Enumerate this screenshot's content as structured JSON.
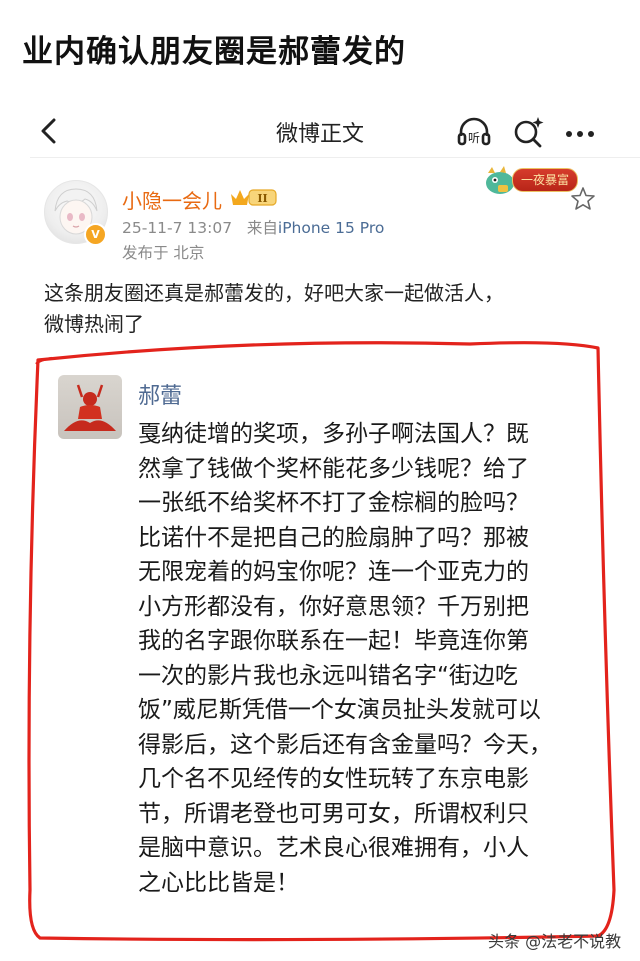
{
  "headline": "业内确认朋友圈是郝蕾发的",
  "navbar": {
    "back_icon": "chevron-left-icon",
    "title": "微博正文",
    "listen_label": "听",
    "search_icon": "search-sparkle-icon",
    "more_icon": "more-horizontal-icon"
  },
  "post": {
    "username": "小隐一会儿",
    "vip_level": "II",
    "timestamp": "25-11-7 13:07",
    "source_prefix": "来自",
    "device": "iPhone 15 Pro",
    "posted_from": "发布于 北京",
    "decoration_badge": "一夜暴富",
    "text_line1": "这条朋友圈还真是郝蕾发的，好吧大家一起做活人，",
    "text_line2": "微博热闹了"
  },
  "quoted": {
    "name": "郝蕾",
    "lines": [
      "戛纳徒增的奖项，多孙子啊法国人？既",
      "然拿了钱做个奖杯能花多少钱呢？给了",
      "一张纸不给奖杯不打了金棕榈的脸吗？",
      "比诺什不是把自己的脸扇肿了吗？那被",
      "无限宠着的妈宝你呢？连一个亚克力的",
      "小方形都没有，你好意思领？千万别把",
      "我的名字跟你联系在一起！毕竟连你第",
      "一次的影片我也永远叫错名字“街边吃",
      "饭”威尼斯凭借一个女演员扯头发就可以",
      "得影后，这个影后还有含金量吗？今天，",
      "几个名不见经传的女性玩转了东京电影",
      "节，所谓老登也可男可女，所谓权利只",
      "是脑中意识。艺术良心很难拥有，小人",
      "之心比比皆是！"
    ]
  },
  "watermark": "头条 @法老不说教",
  "colors": {
    "username": "#e86a12",
    "device_link": "#4b6c95",
    "quoted_name": "#4f6a92",
    "highlight_circle": "#e3231c"
  }
}
